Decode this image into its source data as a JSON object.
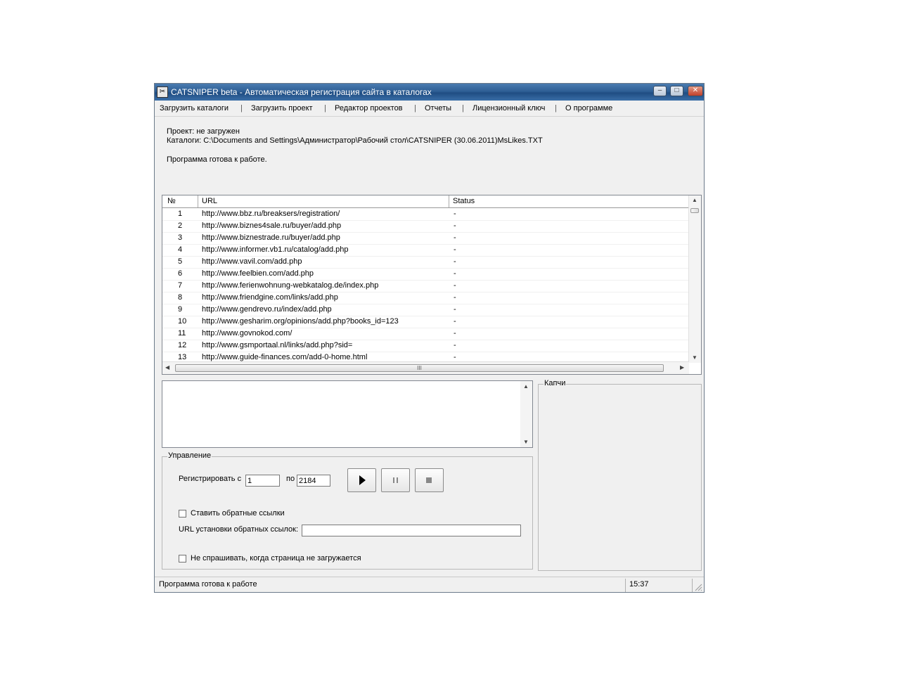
{
  "window": {
    "title": "CATSNIPER beta - Автоматическая регистрация сайта в каталогах",
    "icon": "app-icon",
    "controls": [
      "minimize-icon",
      "maximize-icon",
      "close-icon"
    ]
  },
  "menu": {
    "items": [
      {
        "label": "Загрузить каталоги"
      },
      {
        "label": "Загрузить проект"
      },
      {
        "label": "Редактор проектов"
      },
      {
        "label": "Отчеты"
      },
      {
        "label": "Лицензионный ключ"
      },
      {
        "label": "О программе"
      }
    ],
    "separator": "|"
  },
  "info": {
    "project": "Проект: не загружен",
    "catalogs": "Каталоги: C:\\Documents and Settings\\Администратор\\Рабочий стол\\CATSNIPER (30.06.2011)MsLikes.TXT",
    "status": "Программа готова к работе."
  },
  "table": {
    "columns": [
      "№",
      "URL",
      "Status"
    ],
    "rows": [
      {
        "n": "1",
        "url": "http://www.bbz.ru/breaksers/registration/",
        "status": "-"
      },
      {
        "n": "2",
        "url": "http://www.biznes4sale.ru/buyer/add.php",
        "status": "-"
      },
      {
        "n": "3",
        "url": "http://www.biznestrade.ru/buyer/add.php",
        "status": "-"
      },
      {
        "n": "4",
        "url": "http://www.informer.vb1.ru/catalog/add.php",
        "status": "-"
      },
      {
        "n": "5",
        "url": "http://www.vavil.com/add.php",
        "status": "-"
      },
      {
        "n": "6",
        "url": "http://www.feelbien.com/add.php",
        "status": "-"
      },
      {
        "n": "7",
        "url": "http://www.ferienwohnung-webkatalog.de/index.php",
        "status": "-"
      },
      {
        "n": "8",
        "url": "http://www.friendgine.com/links/add.php",
        "status": "-"
      },
      {
        "n": "9",
        "url": "http://www.gendrevo.ru/index/add.php",
        "status": "-"
      },
      {
        "n": "10",
        "url": "http://www.gesharim.org/opinions/add.php?books_id=123",
        "status": "-"
      },
      {
        "n": "11",
        "url": "http://www.govnokod.com/",
        "status": "-"
      },
      {
        "n": "12",
        "url": "http://www.gsmportaal.nl/links/add.php?sid=",
        "status": "-"
      },
      {
        "n": "13",
        "url": "http://www.guide-finances.com/add-0-home.html",
        "status": "-"
      }
    ],
    "hscroll_grip": "III"
  },
  "control": {
    "title": "Управление",
    "register_from_label": "Регистрировать с",
    "from_value": "1",
    "to_label": "по",
    "to_value": "2184",
    "buttons": [
      "play-icon",
      "pause-icon",
      "stop-icon"
    ],
    "backlinks_label": "Ставить обратные ссылки",
    "backlinks_url_label": "URL установки обратных ссылок:",
    "backlinks_url_value": "",
    "no_ask_label": "Не спрашивать, когда страница не загружается"
  },
  "captcha": {
    "title": "Капчи"
  },
  "statusbar": {
    "text": "Программа готова к работе",
    "time": "15:37"
  }
}
